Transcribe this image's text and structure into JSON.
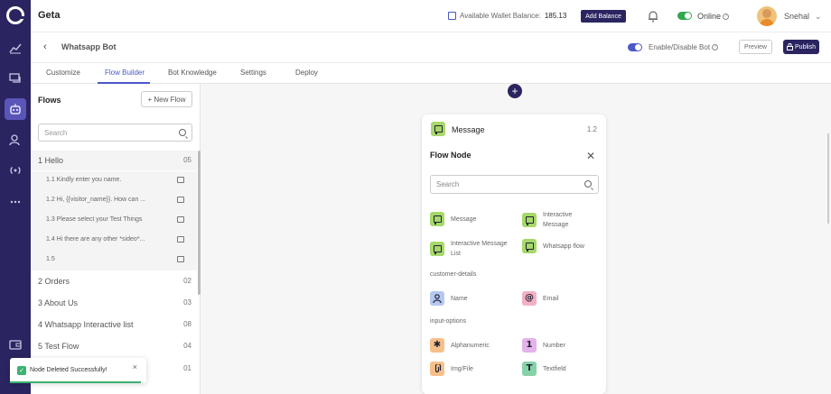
{
  "app": {
    "brand": "Geta"
  },
  "header": {
    "wallet_label": "Available Wallet Balance:",
    "wallet_value": "185.13",
    "add_balance": "Add Balance",
    "online_label": "Online",
    "user_name": "Snehal"
  },
  "subheader": {
    "title": "Whatsapp Bot",
    "enable_label": "Enable/Disable Bot",
    "preview": "Preview",
    "publish": "Publish"
  },
  "tabs": [
    {
      "label": "Customize"
    },
    {
      "label": "Flow Builder",
      "active": true
    },
    {
      "label": "Bot Knowledge"
    },
    {
      "label": "Settings"
    },
    {
      "label": "Deploy"
    }
  ],
  "flows": {
    "title": "Flows",
    "new_flow": "+ New Flow",
    "search_placeholder": "Search",
    "items": [
      {
        "name": "1  Hello",
        "count": "05"
      },
      {
        "name": "2  Orders",
        "count": "02"
      },
      {
        "name": "3  About Us",
        "count": "03"
      },
      {
        "name": "4  Whatsapp Interactive list",
        "count": "08"
      },
      {
        "name": "5  Test Flow",
        "count": "04"
      },
      {
        "name": "",
        "count": "01"
      }
    ],
    "sub_items": [
      {
        "name": "1.1  Kindly enter you name."
      },
      {
        "name": "1.2  Hi, {{visitor_name}}. How can ..."
      },
      {
        "name": "1.3  Please select your Test Things"
      },
      {
        "name": "1.4  Hi there are any other *sideo*..."
      },
      {
        "name": "1.5"
      }
    ]
  },
  "node": {
    "type": "Message",
    "version": "1.2",
    "panel_title": "Flow Node",
    "search_placeholder": "Search",
    "options": [
      {
        "label": "Message",
        "icon": "message-icon",
        "color": "#a6d86a"
      },
      {
        "label": "Interactive Message",
        "icon": "message-icon",
        "color": "#a6d86a"
      },
      {
        "label": "Interactive Message List",
        "icon": "message-icon",
        "color": "#a6d86a"
      },
      {
        "label": "Whatsapp flow",
        "icon": "message-icon",
        "color": "#a6d86a"
      }
    ],
    "section_customer": "customer-details",
    "customer_options": [
      {
        "label": "Name",
        "glyph": "👤",
        "icon": "person-icon",
        "color": "#b5c8f0"
      },
      {
        "label": "Email",
        "glyph": "@",
        "icon": "at-icon",
        "color": "#f4b0c4"
      }
    ],
    "section_input": "input-options",
    "input_options": [
      {
        "label": "Alphanumeric",
        "glyph": "✱",
        "icon": "asterisk-icon",
        "color": "#f7c08a"
      },
      {
        "label": "Number",
        "glyph": "1",
        "icon": "number-icon",
        "color": "#e3b4e9"
      },
      {
        "label": "Img/File",
        "glyph": "@",
        "icon": "attachment-icon",
        "color": "#f7c08a"
      },
      {
        "label": "Textfield",
        "glyph": "T",
        "icon": "text-icon",
        "color": "#86d2a8"
      }
    ]
  },
  "toast": {
    "message": "Node Deleted Successfully!",
    "close": "×"
  }
}
